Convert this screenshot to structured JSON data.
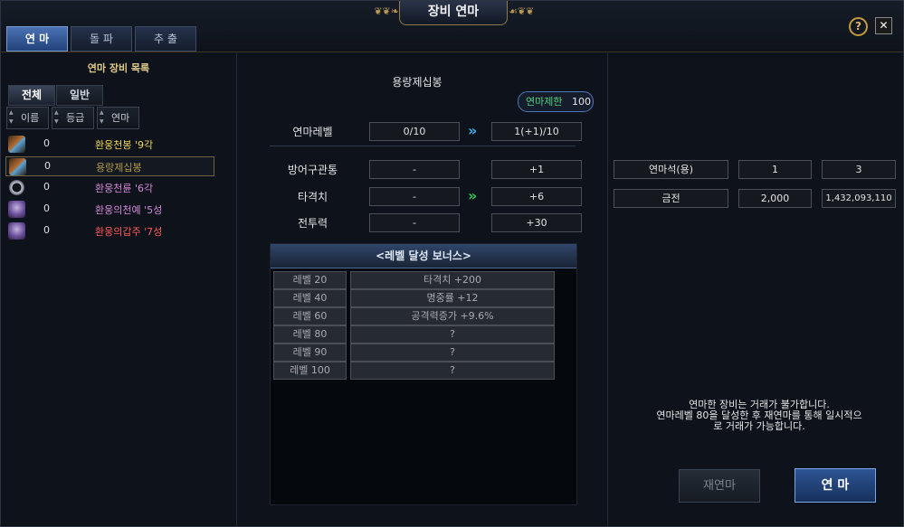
{
  "window": {
    "title": "장비 연마",
    "help": "?",
    "close": "✕"
  },
  "tabs": [
    {
      "label": "연 마",
      "active": true
    },
    {
      "label": "돌 파",
      "active": false
    },
    {
      "label": "추 출",
      "active": false
    }
  ],
  "list": {
    "title": "연마 장비 목록",
    "filters": [
      {
        "label": "전체",
        "active": true
      },
      {
        "label": "일반",
        "active": false
      }
    ],
    "sort_buttons": [
      "이름",
      "등급",
      "연마"
    ],
    "items": [
      {
        "count": "0",
        "name": "환웅천봉 '9각",
        "color": "#f0d75a",
        "icon": "staff-icon",
        "selected": false
      },
      {
        "count": "0",
        "name": "용랑제십봉",
        "color": "#b49a4a",
        "icon": "staff-icon",
        "selected": true
      },
      {
        "count": "0",
        "name": "환웅천륜 '6각",
        "color": "#d58ad9",
        "icon": "ring-icon",
        "selected": false
      },
      {
        "count": "0",
        "name": "환웅의천예 '5성",
        "color": "#d58ad9",
        "icon": "armor-icon",
        "selected": false
      },
      {
        "count": "0",
        "name": "환웅의갑주 '7성",
        "color": "#ff5a5a",
        "icon": "armor-icon",
        "selected": false
      }
    ]
  },
  "detail": {
    "item_name": "용랑제십봉",
    "limit_label": "연마제한",
    "limit_value": "100",
    "level": {
      "label": "연마레벨",
      "current": "0/10",
      "next": "1(+1)/10"
    },
    "stats": [
      {
        "label": "방어구관통",
        "current": "-",
        "next": "+1"
      },
      {
        "label": "타격치",
        "current": "-",
        "next": "+6"
      },
      {
        "label": "전투력",
        "current": "-",
        "next": "+30"
      }
    ],
    "bonus_title": "<레벨 달성 보너스>",
    "bonus": [
      {
        "level": "레벨 20",
        "effect": "타격치 +200"
      },
      {
        "level": "레벨 40",
        "effect": "명중률 +12"
      },
      {
        "level": "레벨 60",
        "effect": "공격력증가 +9.6%"
      },
      {
        "level": "레벨 80",
        "effect": "?"
      },
      {
        "level": "레벨 90",
        "effect": "?"
      },
      {
        "level": "레벨 100",
        "effect": "?"
      }
    ]
  },
  "materials": [
    {
      "name": "연마석(용)",
      "required": "1",
      "owned": "3"
    },
    {
      "name": "금전",
      "required": "2,000",
      "owned": "1,432,093,110"
    }
  ],
  "notice": [
    "연마한 장비는 거래가 불가합니다.",
    "연마레벨 80을 달성한 후 재연마를 통해 일시적으",
    "로 거래가 가능합니다."
  ],
  "buttons": {
    "reroll": "재연마",
    "refine": "연 마"
  }
}
